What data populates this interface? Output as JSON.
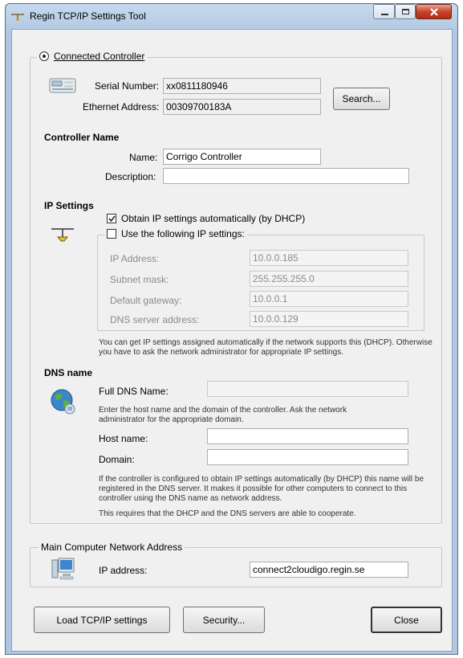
{
  "window": {
    "title": "Regin TCP/IP Settings Tool"
  },
  "connected": {
    "label": "Connected Controller",
    "serial_label": "Serial Number:",
    "serial_value": "xx0811180946",
    "ethernet_label": "Ethernet Address:",
    "ethernet_value": "00309700183A",
    "search_label": "Search..."
  },
  "controller_name": {
    "heading": "Controller Name",
    "name_label": "Name:",
    "name_value": "Corrigo Controller",
    "description_label": "Description:",
    "description_value": ""
  },
  "ip_settings": {
    "heading": "IP Settings",
    "dhcp_label": "Obtain IP settings automatically (by DHCP)",
    "dhcp_checked": true,
    "manual_label": "Use the following IP settings:",
    "manual_checked": false,
    "ip_label": "IP Address:",
    "ip_value": "10.0.0.185",
    "subnet_label": "Subnet mask:",
    "subnet_value": "255.255.255.0",
    "gateway_label": "Default gateway:",
    "gateway_value": "10.0.0.1",
    "dns_label": "DNS server address:",
    "dns_value": "10.0.0.129",
    "note_line1": "You can get IP settings assigned automatically if the network supports this (DHCP). Otherwise",
    "note_line2": "you have to ask the network administrator for appropriate IP settings."
  },
  "dns_name": {
    "heading": "DNS name",
    "full_label": "Full DNS Name:",
    "full_value": "",
    "hint_line1": "Enter the host name and the domain of the controller. Ask the network",
    "hint_line2": "administrator for the appropriate domain.",
    "host_label": "Host name:",
    "host_value": "",
    "domain_label": "Domain:",
    "domain_value": "",
    "info_line1": "If the controller is configured to obtain IP settings automatically (by DHCP) this name will be",
    "info_line2": "registered in the DNS server. It makes it possible for other computers to connect to this",
    "info_line3": "controller using the DNS name as network address.",
    "info_line4": "This requires that the DHCP and the DNS servers are able to cooperate."
  },
  "main_computer": {
    "heading": "Main Computer Network Address",
    "ip_label": "IP address:",
    "ip_value": "connect2cloudigo.regin.se"
  },
  "buttons": {
    "load": "Load TCP/IP settings",
    "security": "Security...",
    "close": "Close"
  }
}
